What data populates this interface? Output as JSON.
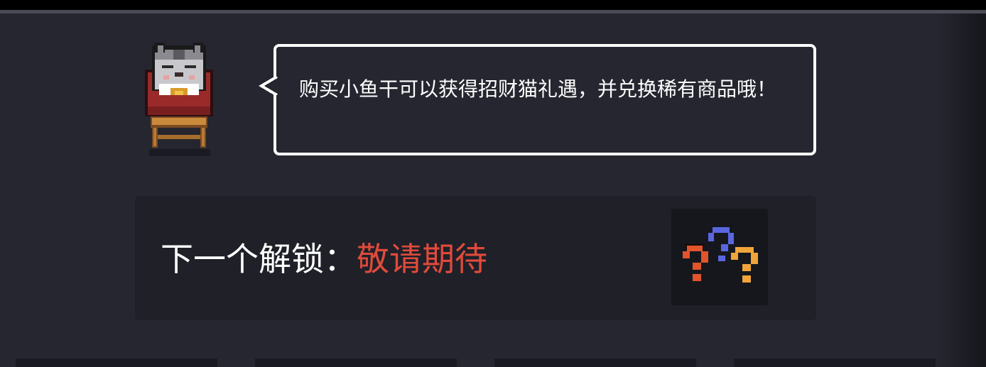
{
  "npc": {
    "name_icon": "lucky-cat-icon"
  },
  "dialog": {
    "text": "购买小鱼干可以获得招财猫礼遇，并兑换稀有商品哦！"
  },
  "unlock": {
    "label": "下一个解锁：",
    "value": "敬请期待",
    "icon": "mystery-question-icon"
  },
  "colors": {
    "background": "#25262f",
    "panel": "#1f2028",
    "highlight_red": "#e04a3b",
    "question_orange": "#e2552c",
    "question_blue": "#5a66e0",
    "question_yellow": "#f0a43a"
  }
}
